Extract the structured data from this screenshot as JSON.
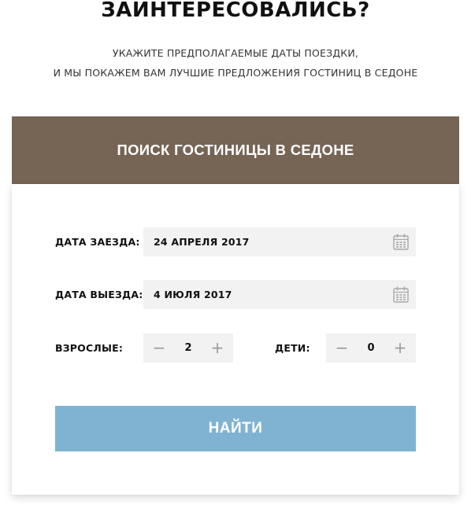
{
  "intro": {
    "title": "ЗАИНТЕРЕСОВАЛИСЬ?",
    "subtitle_line1": "УКАЖИТЕ ПРЕДПОЛАГАЕМЫЕ ДАТЫ ПОЕЗДКИ,",
    "subtitle_line2": "И МЫ ПОКАЖЕМ ВАМ ЛУЧШИЕ ПРЕДЛОЖЕНИЯ ГОСТИНИЦ В СЕДОНЕ"
  },
  "form": {
    "header": "ПОИСК ГОСТИНИЦЫ В СЕДОНЕ",
    "checkin_label": "ДАТА ЗАЕЗДА:",
    "checkin_value": "24 АПРЕЛЯ 2017",
    "checkout_label": "ДАТА ВЫЕЗДА:",
    "checkout_value": "4 ИЮЛЯ 2017",
    "adults_label": "ВЗРОСЛЫЕ:",
    "adults_value": "2",
    "children_label": "ДЕТИ:",
    "children_value": "0",
    "minus_symbol": "−",
    "plus_symbol": "+",
    "submit_label": "НАЙТИ",
    "calendar_icon": "calendar-icon"
  },
  "colors": {
    "header_bg": "#766455",
    "button_bg": "#80b3d2",
    "field_bg": "#f2f2f2",
    "icon_gray": "#a8a8a8"
  }
}
